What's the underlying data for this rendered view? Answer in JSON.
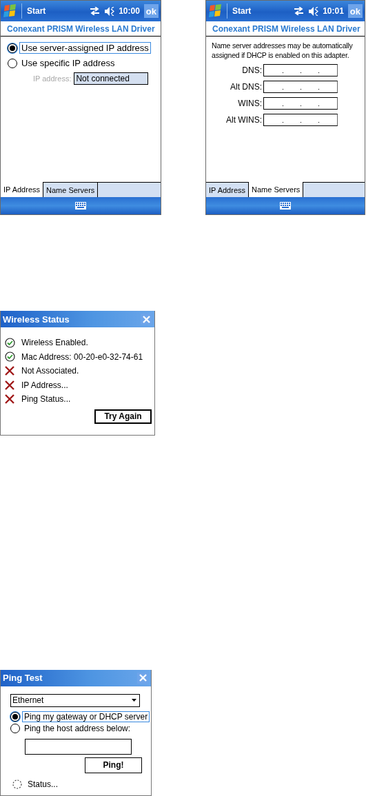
{
  "screens": [
    {
      "kind": "ip_address",
      "start": "Start",
      "time": "10:00",
      "ok": "ok",
      "header": "Conexant PRISM Wireless LAN Driver",
      "options": [
        {
          "label": "Use server-assigned IP address",
          "selected": true
        },
        {
          "label": "Use specific IP address",
          "selected": false
        }
      ],
      "ip_field": {
        "label": "IP address:",
        "value": "Not connected",
        "disabled": true
      },
      "tabs": [
        {
          "label": "IP Address",
          "selected": true
        },
        {
          "label": "Name Servers",
          "selected": false
        }
      ]
    },
    {
      "kind": "name_servers",
      "start": "Start",
      "time": "10:01",
      "ok": "ok",
      "header": "Conexant PRISM Wireless LAN Driver",
      "note": "Name server addresses may be automatically assigned if DHCP is enabled on this adapter.",
      "fields": [
        {
          "label": "DNS:"
        },
        {
          "label": "Alt DNS:"
        },
        {
          "label": "WINS:"
        },
        {
          "label": "Alt WINS:"
        }
      ],
      "tabs": [
        {
          "label": "IP Address",
          "selected": false
        },
        {
          "label": "Name Servers",
          "selected": true
        }
      ]
    }
  ],
  "wireless_status": {
    "title": "Wireless Status",
    "items": [
      {
        "kind": "ok",
        "text": "Wireless Enabled."
      },
      {
        "kind": "ok",
        "text": "Mac Address: 00-20-e0-32-74-61"
      },
      {
        "kind": "fail",
        "text": "Not Associated."
      },
      {
        "kind": "fail",
        "text": "IP Address..."
      },
      {
        "kind": "fail",
        "text": "Ping Status..."
      }
    ],
    "button": "Try Again"
  },
  "ping_test": {
    "title": "Ping Test",
    "adapter": "Ethernet",
    "options": [
      {
        "label": "Ping my gateway or DHCP server",
        "selected": true
      },
      {
        "label": "Ping the host address below:",
        "selected": false
      }
    ],
    "button": "Ping!",
    "status": "Status..."
  }
}
